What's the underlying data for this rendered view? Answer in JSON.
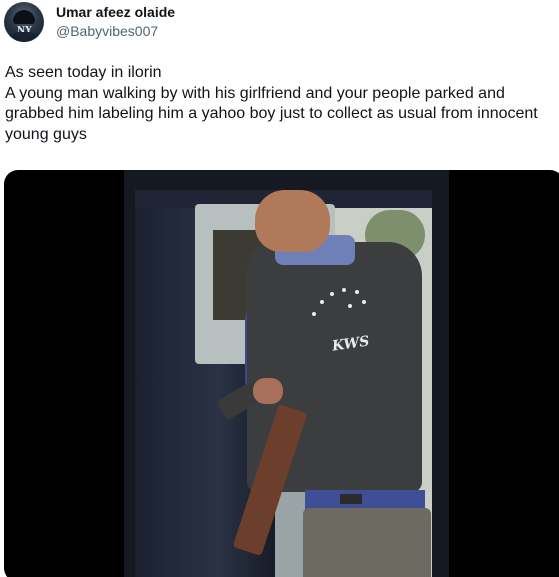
{
  "tweet": {
    "author": {
      "display_name": "Umar afeez olaide",
      "handle": "@Babyvibes007",
      "avatar_icon": "user-avatar-ny-cap"
    },
    "text_lines": [
      "As seen today in ilorin",
      "A young man walking by with his girlfriend and your people parked and grabbed him labeling him a yahoo boy just to collect as usual from innocent young  guys"
    ],
    "media": {
      "type": "video",
      "vest_text": "KWS"
    }
  }
}
